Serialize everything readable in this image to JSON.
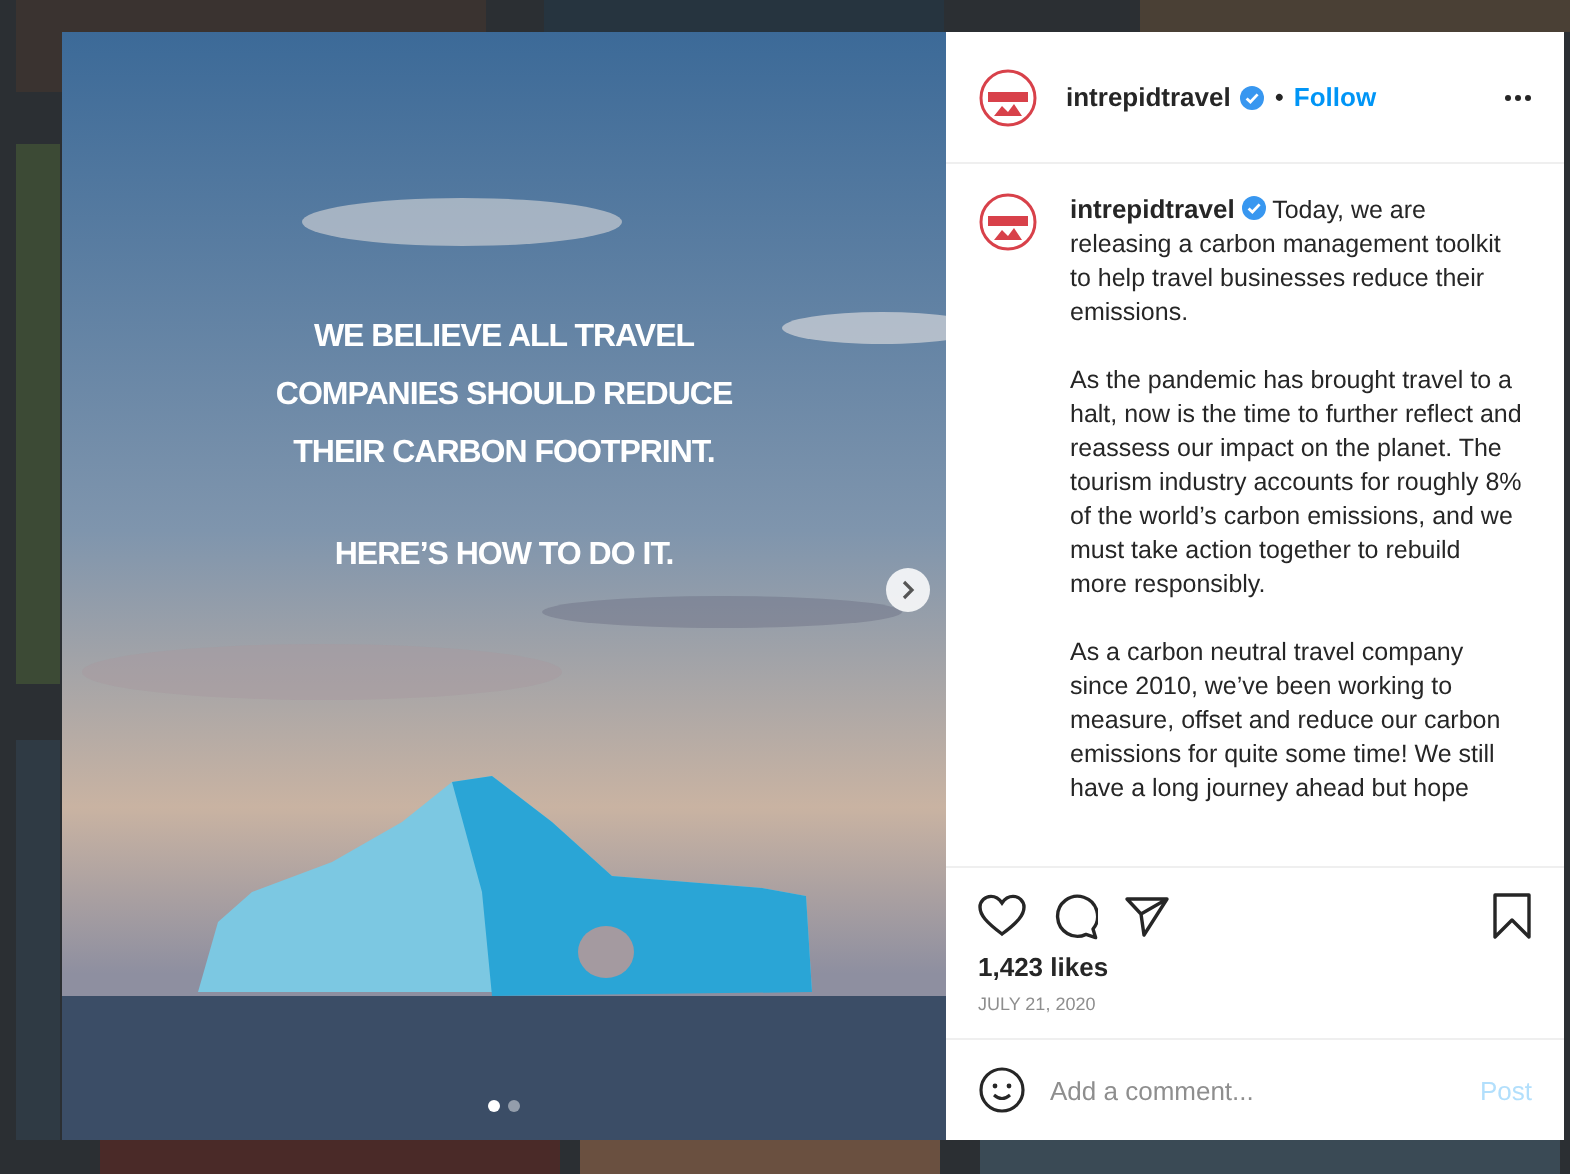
{
  "post": {
    "image": {
      "kind": "picture",
      "overlay_lines": [
        "WE BELIEVE ALL TRAVEL",
        "COMPANIES SHOULD REDUCE",
        "THEIR CARBON FOOTPRINT."
      ],
      "overlay_tagline": "HERE’S HOW TO DO IT."
    },
    "carousel_dots": [
      {
        "selected": true
      },
      {
        "selected": false
      }
    ]
  },
  "header": {
    "username": "intrepidtravel",
    "verified": true,
    "separator": "•",
    "follow": "Follow"
  },
  "caption": {
    "username": "intrepidtravel",
    "verified": true,
    "paragraphs": [
      "Today, we are releasing a carbon management toolkit to help travel businesses reduce their emissions.",
      "As the pandemic has brought travel to a halt, now is the time to further reflect and reassess our impact on the planet. The tourism industry accounts for roughly 8% of the world’s carbon emissions, and we must take action together to rebuild more responsibly.",
      "As a carbon neutral travel company since 2010, we’ve been working to measure, offset and reduce our carbon emissions for quite some time! We still have a long journey ahead but hope"
    ]
  },
  "likes": "1,423 likes",
  "date": "JULY 21, 2020",
  "comment": {
    "placeholder": "Add a comment...",
    "post_button": "Post",
    "post_disabled": true
  }
}
